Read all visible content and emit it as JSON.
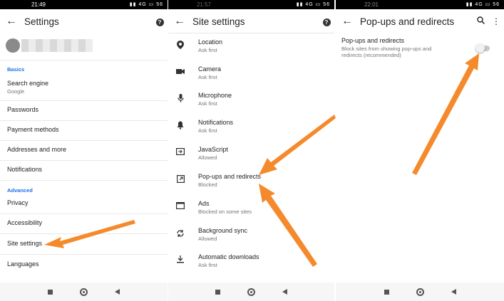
{
  "panel1": {
    "status_time": "21:49",
    "status_right": "▮▮ 4G ▭ 56",
    "title": "Settings",
    "back_icon": "arrow-left-icon",
    "help_icon": "help-icon",
    "help_glyph": "?",
    "basics_label": "Basics",
    "search_engine_title": "Search engine",
    "search_engine_value": "Google",
    "items": [
      "Passwords",
      "Payment methods",
      "Addresses and more",
      "Notifications"
    ],
    "advanced_label": "Advanced",
    "advanced_items": [
      "Privacy",
      "Accessibility",
      "Site settings",
      "Languages"
    ]
  },
  "panel2": {
    "status_time": "21:57",
    "status_right": "▮▮ 4G ▭ 56",
    "title": "Site settings",
    "help_glyph": "?",
    "rows": [
      {
        "title": "Location",
        "sub": "Ask first",
        "icon": "location-pin-icon",
        "glyph": "⬤"
      },
      {
        "title": "Camera",
        "sub": "Ask first",
        "icon": "camera-icon",
        "glyph": "■"
      },
      {
        "title": "Microphone",
        "sub": "Ask first",
        "icon": "microphone-icon",
        "glyph": "🎙"
      },
      {
        "title": "Notifications",
        "sub": "Ask first",
        "icon": "bell-icon",
        "glyph": "🔔"
      },
      {
        "title": "JavaScript",
        "sub": "Allowed",
        "icon": "javascript-icon",
        "glyph": "⇥"
      },
      {
        "title": "Pop-ups and redirects",
        "sub": "Blocked",
        "icon": "popup-icon",
        "glyph": "↗"
      },
      {
        "title": "Ads",
        "sub": "Blocked on some sites",
        "icon": "ads-icon",
        "glyph": "▭"
      },
      {
        "title": "Background sync",
        "sub": "Allowed",
        "icon": "sync-icon",
        "glyph": "⟳"
      },
      {
        "title": "Automatic downloads",
        "sub": "Ask first",
        "icon": "download-icon",
        "glyph": "⤓"
      }
    ]
  },
  "panel3": {
    "status_time": "22:01",
    "status_right": "▮▮ 4G ▭ 56",
    "title": "Pop-ups and redirects",
    "search_glyph": "⚲",
    "more_glyph": "⋮",
    "setting_title": "Pop-ups and redirects",
    "setting_desc_line1": "Block sites from showing pop-ups and",
    "setting_desc_line2": "redirects (recommended)",
    "toggle_on": false
  },
  "colors": {
    "arrow": "#f58a2c",
    "accent": "#1a73e8"
  }
}
